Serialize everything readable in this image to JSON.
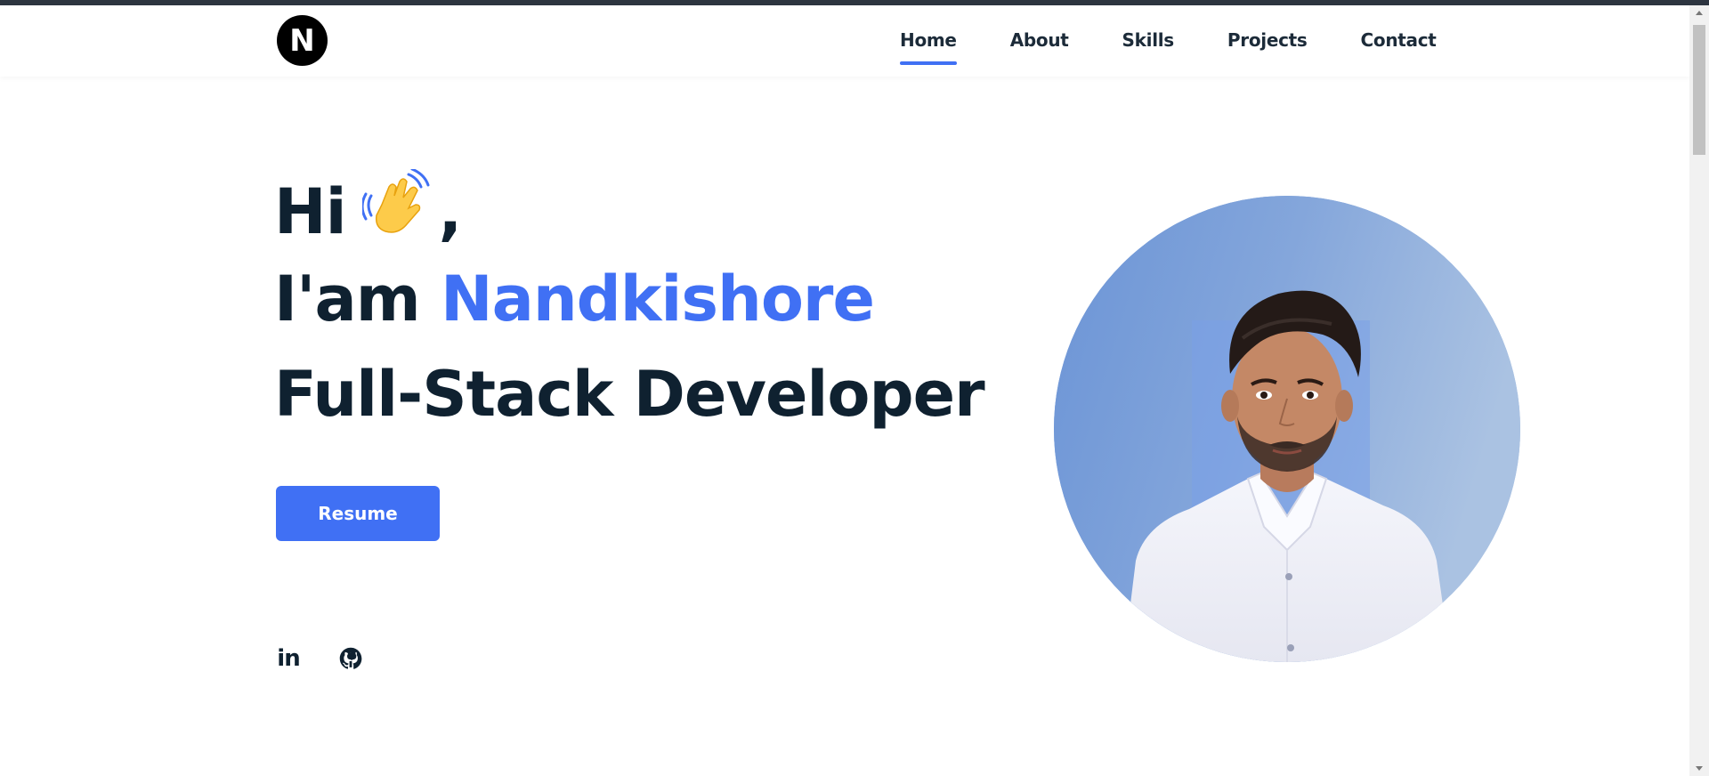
{
  "brand": {
    "logo_letter": "N"
  },
  "nav": {
    "items": [
      {
        "label": "Home",
        "active": true
      },
      {
        "label": "About",
        "active": false
      },
      {
        "label": "Skills",
        "active": false
      },
      {
        "label": "Projects",
        "active": false
      },
      {
        "label": "Contact",
        "active": false
      }
    ]
  },
  "hero": {
    "greeting": "Hi",
    "greeting_suffix": ",",
    "intro_prefix": "I'am ",
    "name": "Nandkishore",
    "role": "Full-Stack Developer",
    "resume_label": "Resume"
  },
  "social": {
    "linkedin_label": "in",
    "icons": [
      "linkedin-icon",
      "github-icon"
    ]
  },
  "colors": {
    "accent": "#4070f4",
    "text": "#0f2130",
    "header_strip": "#2d3540"
  }
}
